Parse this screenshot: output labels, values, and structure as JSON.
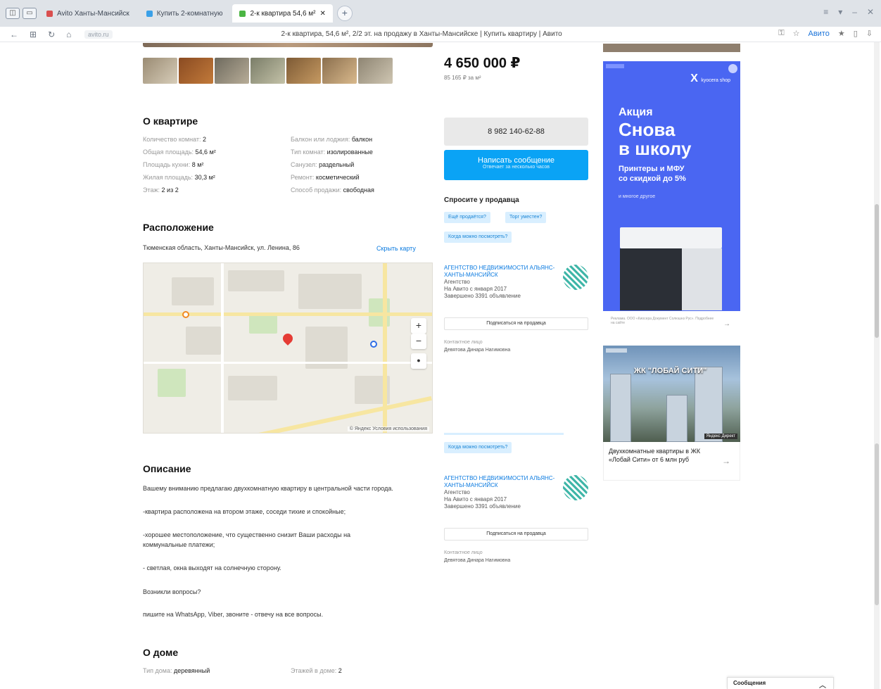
{
  "browser": {
    "tabs": [
      {
        "label": "Avito Ханты-Мансийск",
        "color": "#d94f4f"
      },
      {
        "label": "Купить 2-комнатную",
        "color": "#3aa0e8"
      },
      {
        "label": "2-к квартира 54,6 м²",
        "color": "#4bb543"
      }
    ],
    "new_tab": "+",
    "url_chip": "avito.ru",
    "page_title": "2-к квартира, 54,6 м², 2/2 эт. на продажу в Ханты-Мансийске | Купить квартиру | Авито",
    "addr_link": "Авито",
    "win_controls": [
      "≡",
      "▾",
      "–",
      "✕"
    ],
    "nav": [
      "←",
      "⊞",
      "↻",
      "⌂"
    ]
  },
  "listing": {
    "price": "4 650 000 ₽",
    "price_per_m": "85 165 ₽ за м²",
    "phone": "8 982 140-62-88",
    "message_button": "Написать сообщение",
    "message_sub": "Отвечает за несколько часов",
    "ask_title": "Спросите у продавца",
    "ask_chips": [
      "Ещё продаётся?",
      "Торг уместен?",
      "Когда можно посмотреть?"
    ]
  },
  "about": {
    "title": "О квартире",
    "left": [
      {
        "k": "Количество комнат:",
        "v": "2"
      },
      {
        "k": "Общая площадь:",
        "v": "54,6 м²"
      },
      {
        "k": "Площадь кухни:",
        "v": "8 м²"
      },
      {
        "k": "Жилая площадь:",
        "v": "30,3 м²"
      },
      {
        "k": "Этаж:",
        "v": "2 из 2"
      }
    ],
    "right": [
      {
        "k": "Балкон или лоджия:",
        "v": "балкон"
      },
      {
        "k": "Тип комнат:",
        "v": "изолированные"
      },
      {
        "k": "Санузел:",
        "v": "раздельный"
      },
      {
        "k": "Ремонт:",
        "v": "косметический"
      },
      {
        "k": "Способ продажи:",
        "v": "свободная"
      }
    ]
  },
  "location": {
    "title": "Расположение",
    "address": "Тюменская область, Ханты-Мансийск, ул. Ленина, 86",
    "map_link": "Скрыть карту",
    "map_copyright": "© Яндекс  Условия использования",
    "zoom_in": "+",
    "zoom_out": "−",
    "locate": "●"
  },
  "description": {
    "title": "Описание",
    "lines": [
      "Вашему вниманию предлагаю двухкомнатную квартиру в центральной части города.",
      "-квартира расположена на втором этаже, соседи тихие и спокойные;",
      "-хорошее местоположение, что существенно снизит Ваши расходы на",
      "коммунальные платежи;",
      "- светлая, окна выходят на солнечную сторону.",
      "Возникли вопросы?",
      "пишите на WhatsApp, Viber, звоните - отвечу на все вопросы."
    ]
  },
  "house": {
    "title": "О доме",
    "left": {
      "k": "Тип дома:",
      "v": "деревянный"
    },
    "right": {
      "k": "Этажей в доме:",
      "v": "2"
    }
  },
  "agencies": [
    {
      "name": "АГЕНТСТВО НЕДВИЖИМОСТИ АЛЬЯНС-ХАНТЫ-МАНСИЙСК",
      "type": "Агентство",
      "since": "На Авито с января 2017",
      "completed": "Завершено 3391 объявление",
      "subscribe": "Подписаться на продавца",
      "contact_label": "Контактное лицо",
      "contact": "Девятова Динара Нагимовна"
    },
    {
      "name": "АГЕНТСТВО НЕДВИЖИМОСТИ АЛЬЯНС-ХАНТЫ-МАНСИЙСК",
      "type": "Агентство",
      "since": "На Авито с января 2017",
      "completed": "Завершено 3391 объявление",
      "subscribe": "Подписаться на продавца",
      "contact_label": "Контактное лицо",
      "contact": "Девятова Динара Нагимовна"
    }
  ],
  "ads": {
    "blue": {
      "brand": "X",
      "brand_sub": "kyocera shop",
      "h1": "Акция",
      "h2a": "Снова",
      "h2b": "в школу",
      "h3a": "Принтеры и МФУ",
      "h3b": "со скидкой до 5%",
      "small": "и многое другое",
      "fine": "Реклама. ООО «Киосера Документ Солюшнз Рус». Подробнее на сайте"
    },
    "photo": {
      "label": "ЖК \"ЛОБАЙ СИТИ\"",
      "tag": "Яндекс Директ",
      "text": "Двухкомнатные квартиры в ЖК «Лобай Сити» от 6 млн руб"
    },
    "accent": "#4a66f2"
  },
  "chat": {
    "label": "Сообщения",
    "toggle": "︿"
  }
}
